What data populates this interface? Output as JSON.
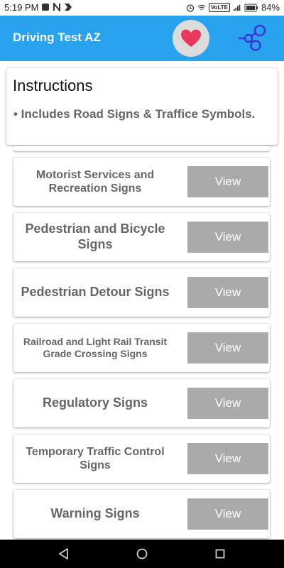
{
  "status_bar": {
    "time": "5:19 PM",
    "volte": "VoLTE",
    "battery": "84%"
  },
  "app_bar": {
    "title": "Driving Test AZ",
    "heart_icon": "heart-icon",
    "share_icon": "share-icon"
  },
  "instructions": {
    "title": "Instructions",
    "bullet": "• Includes Road Signs & Traffice Symbols."
  },
  "categories": [
    {
      "label": "Motorist Services and Recreation Signs",
      "button": "View"
    },
    {
      "label": "Pedestrian and Bicycle Signs",
      "button": "View"
    },
    {
      "label": "Pedestrian Detour Signs",
      "button": "View"
    },
    {
      "label": "Railroad and Light Rail Transit Grade Crossing Signs",
      "button": "View"
    },
    {
      "label": "Regulatory Signs",
      "button": "View"
    },
    {
      "label": "Temporary Traffic Control Signs",
      "button": "View"
    },
    {
      "label": "Warning Signs",
      "button": "View"
    }
  ],
  "colors": {
    "app_bar": "#29a3ee",
    "heart": "#e8385b",
    "button": "#aaaaaa",
    "label_text": "#666666"
  }
}
